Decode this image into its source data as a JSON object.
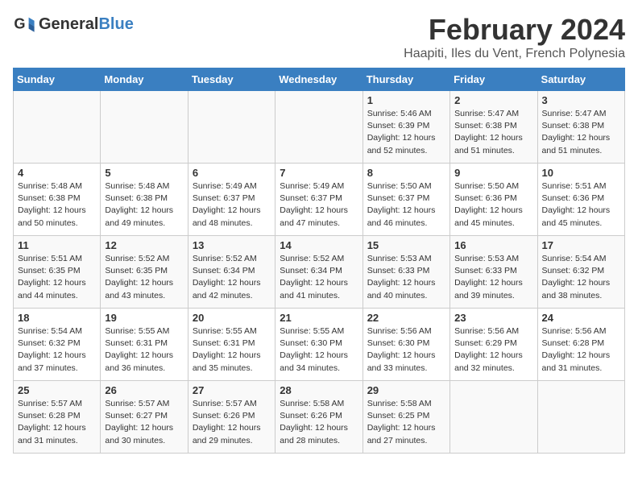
{
  "logo": {
    "general": "General",
    "blue": "Blue"
  },
  "title": "February 2024",
  "subtitle": "Haapiti, Iles du Vent, French Polynesia",
  "days_of_week": [
    "Sunday",
    "Monday",
    "Tuesday",
    "Wednesday",
    "Thursday",
    "Friday",
    "Saturday"
  ],
  "weeks": [
    [
      {
        "day": "",
        "info": ""
      },
      {
        "day": "",
        "info": ""
      },
      {
        "day": "",
        "info": ""
      },
      {
        "day": "",
        "info": ""
      },
      {
        "day": "1",
        "info": "Sunrise: 5:46 AM\nSunset: 6:39 PM\nDaylight: 12 hours and 52 minutes."
      },
      {
        "day": "2",
        "info": "Sunrise: 5:47 AM\nSunset: 6:38 PM\nDaylight: 12 hours and 51 minutes."
      },
      {
        "day": "3",
        "info": "Sunrise: 5:47 AM\nSunset: 6:38 PM\nDaylight: 12 hours and 51 minutes."
      }
    ],
    [
      {
        "day": "4",
        "info": "Sunrise: 5:48 AM\nSunset: 6:38 PM\nDaylight: 12 hours and 50 minutes."
      },
      {
        "day": "5",
        "info": "Sunrise: 5:48 AM\nSunset: 6:38 PM\nDaylight: 12 hours and 49 minutes."
      },
      {
        "day": "6",
        "info": "Sunrise: 5:49 AM\nSunset: 6:37 PM\nDaylight: 12 hours and 48 minutes."
      },
      {
        "day": "7",
        "info": "Sunrise: 5:49 AM\nSunset: 6:37 PM\nDaylight: 12 hours and 47 minutes."
      },
      {
        "day": "8",
        "info": "Sunrise: 5:50 AM\nSunset: 6:37 PM\nDaylight: 12 hours and 46 minutes."
      },
      {
        "day": "9",
        "info": "Sunrise: 5:50 AM\nSunset: 6:36 PM\nDaylight: 12 hours and 45 minutes."
      },
      {
        "day": "10",
        "info": "Sunrise: 5:51 AM\nSunset: 6:36 PM\nDaylight: 12 hours and 45 minutes."
      }
    ],
    [
      {
        "day": "11",
        "info": "Sunrise: 5:51 AM\nSunset: 6:35 PM\nDaylight: 12 hours and 44 minutes."
      },
      {
        "day": "12",
        "info": "Sunrise: 5:52 AM\nSunset: 6:35 PM\nDaylight: 12 hours and 43 minutes."
      },
      {
        "day": "13",
        "info": "Sunrise: 5:52 AM\nSunset: 6:34 PM\nDaylight: 12 hours and 42 minutes."
      },
      {
        "day": "14",
        "info": "Sunrise: 5:52 AM\nSunset: 6:34 PM\nDaylight: 12 hours and 41 minutes."
      },
      {
        "day": "15",
        "info": "Sunrise: 5:53 AM\nSunset: 6:33 PM\nDaylight: 12 hours and 40 minutes."
      },
      {
        "day": "16",
        "info": "Sunrise: 5:53 AM\nSunset: 6:33 PM\nDaylight: 12 hours and 39 minutes."
      },
      {
        "day": "17",
        "info": "Sunrise: 5:54 AM\nSunset: 6:32 PM\nDaylight: 12 hours and 38 minutes."
      }
    ],
    [
      {
        "day": "18",
        "info": "Sunrise: 5:54 AM\nSunset: 6:32 PM\nDaylight: 12 hours and 37 minutes."
      },
      {
        "day": "19",
        "info": "Sunrise: 5:55 AM\nSunset: 6:31 PM\nDaylight: 12 hours and 36 minutes."
      },
      {
        "day": "20",
        "info": "Sunrise: 5:55 AM\nSunset: 6:31 PM\nDaylight: 12 hours and 35 minutes."
      },
      {
        "day": "21",
        "info": "Sunrise: 5:55 AM\nSunset: 6:30 PM\nDaylight: 12 hours and 34 minutes."
      },
      {
        "day": "22",
        "info": "Sunrise: 5:56 AM\nSunset: 6:30 PM\nDaylight: 12 hours and 33 minutes."
      },
      {
        "day": "23",
        "info": "Sunrise: 5:56 AM\nSunset: 6:29 PM\nDaylight: 12 hours and 32 minutes."
      },
      {
        "day": "24",
        "info": "Sunrise: 5:56 AM\nSunset: 6:28 PM\nDaylight: 12 hours and 31 minutes."
      }
    ],
    [
      {
        "day": "25",
        "info": "Sunrise: 5:57 AM\nSunset: 6:28 PM\nDaylight: 12 hours and 31 minutes."
      },
      {
        "day": "26",
        "info": "Sunrise: 5:57 AM\nSunset: 6:27 PM\nDaylight: 12 hours and 30 minutes."
      },
      {
        "day": "27",
        "info": "Sunrise: 5:57 AM\nSunset: 6:26 PM\nDaylight: 12 hours and 29 minutes."
      },
      {
        "day": "28",
        "info": "Sunrise: 5:58 AM\nSunset: 6:26 PM\nDaylight: 12 hours and 28 minutes."
      },
      {
        "day": "29",
        "info": "Sunrise: 5:58 AM\nSunset: 6:25 PM\nDaylight: 12 hours and 27 minutes."
      },
      {
        "day": "",
        "info": ""
      },
      {
        "day": "",
        "info": ""
      }
    ]
  ]
}
